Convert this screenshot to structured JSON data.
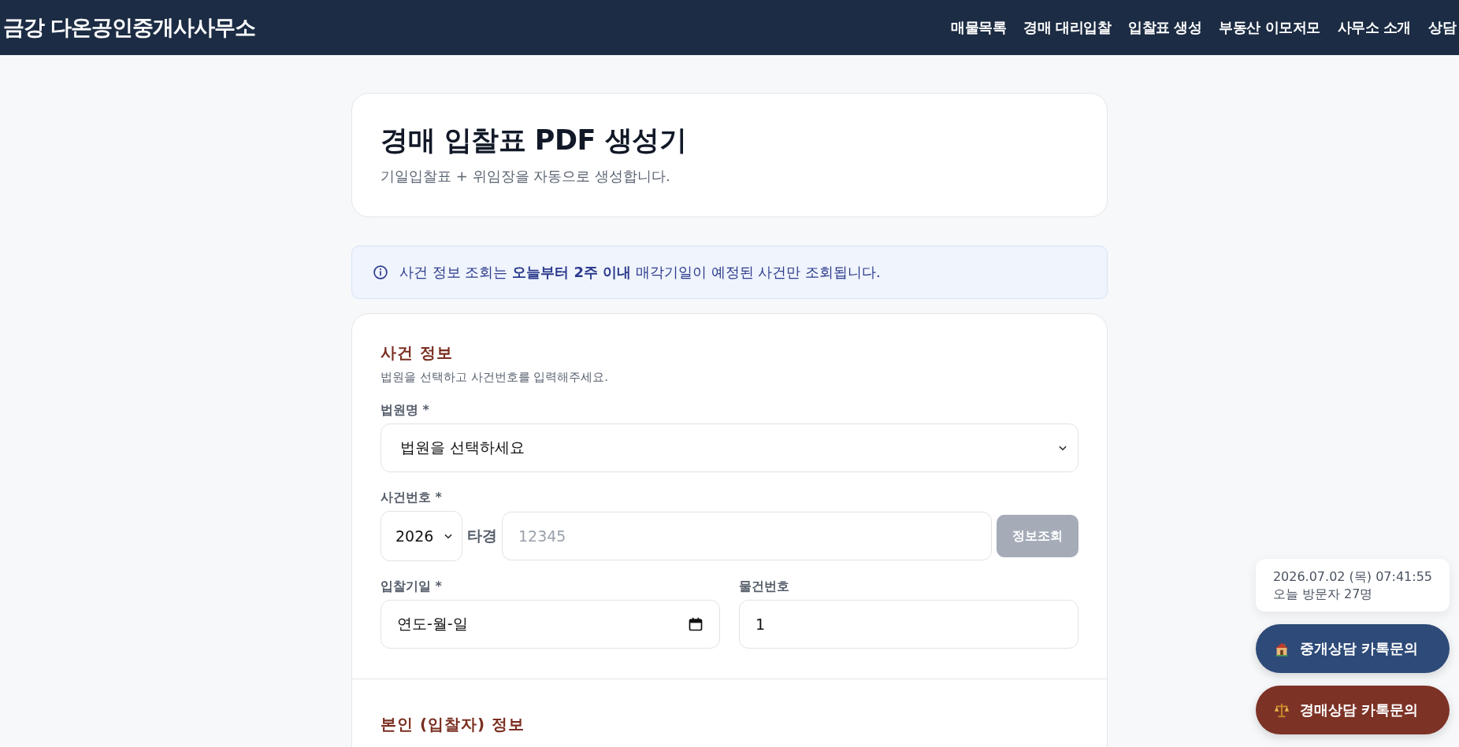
{
  "header": {
    "title": "금강 다온공인중개사사무소",
    "nav": [
      {
        "label": "매물목록"
      },
      {
        "label": "경매 대리입찰"
      },
      {
        "label": "입찰표 생성"
      },
      {
        "label": "부동산 이모저모"
      },
      {
        "label": "사무소 소개"
      },
      {
        "label": "상담"
      }
    ]
  },
  "intro": {
    "title": "경매 입찰표 PDF 생성기",
    "subtitle": "기일입찰표 + 위임장을 자동으로 생성합니다."
  },
  "notice": {
    "text": "사건 정보 조회는 **오늘부터 2주 이내** 매각기일이 예정된 사건만 조회됩니다."
  },
  "form": {
    "sections": [
      {
        "title": "사건 정보",
        "subtitle": "법원을 선택하고 사건번호를 입력해주세요.",
        "fields": [
          {
            "kind": "select",
            "label": "법원명 *",
            "value": "법원을 선택하세요"
          },
          {
            "kind": "case_number",
            "label": "사건번호 *",
            "year": "2026",
            "infix": "타경",
            "placeholder": "12345",
            "button": {
              "label": "정보조회",
              "disabled": true
            }
          },
          {
            "kind": "pair",
            "items": [
              {
                "kind": "date",
                "label": "입찰기일 *",
                "placeholder": "연도-월-일"
              },
              {
                "kind": "text",
                "label": "물건번호",
                "value": "1"
              }
            ]
          }
        ]
      },
      {
        "title": "본인 (입찰자) 정보"
      }
    ]
  },
  "widgets": {
    "clock": {
      "datetime": "2026.07.02 (목) 07:41:55",
      "visitors": "오늘 방문자 27명"
    },
    "buttons": [
      {
        "kind": "brokerage",
        "label": "중개상담 카톡문의",
        "color": "#2d4a78"
      },
      {
        "kind": "auction",
        "label": "경매상담 카톡문의",
        "color": "#7d3226"
      }
    ]
  }
}
